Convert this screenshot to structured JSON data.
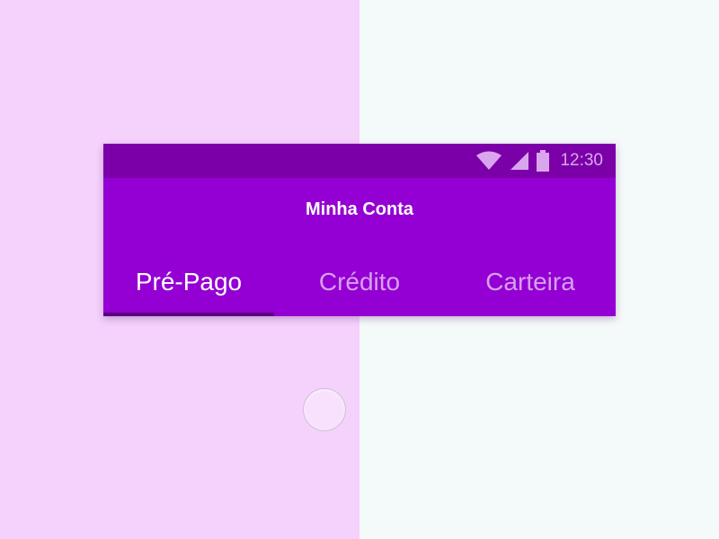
{
  "status_bar": {
    "time": "12:30",
    "icons": [
      "wifi-icon",
      "cellular-signal-icon",
      "battery-icon"
    ]
  },
  "toolbar": {
    "title": "Minha Conta"
  },
  "tabs": [
    {
      "label": "Pré-Pago",
      "active": true
    },
    {
      "label": "Crédito",
      "active": false
    },
    {
      "label": "Carteira",
      "active": false
    }
  ],
  "colors": {
    "primary": "#9400d3",
    "primary_dark": "#7b00a8",
    "tab_inactive": "#d6a0ee",
    "indicator": "#5a0080",
    "background_left": "#f4d2fb",
    "background_right": "#f4f9f9"
  }
}
